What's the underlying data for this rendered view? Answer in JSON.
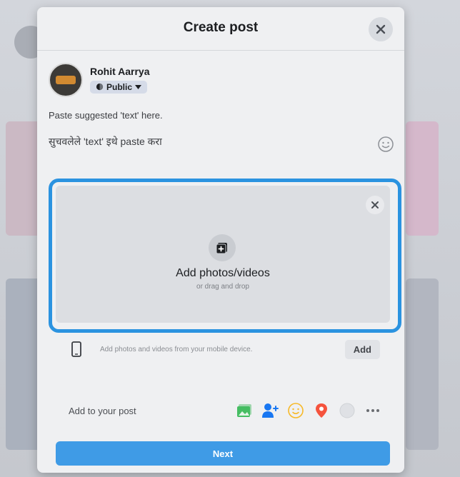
{
  "modal": {
    "title": "Create post",
    "close_icon": "close-icon"
  },
  "user": {
    "name": "Rohit Aarrya",
    "privacy": "Public",
    "privacy_icon": "globe-icon"
  },
  "post": {
    "line1": "Paste suggested 'text' here.",
    "line2": "सुचवलेले 'text' इथे paste करा",
    "emoji_icon": "smiley-icon"
  },
  "upload": {
    "title": "Add photos/videos",
    "subtitle": "or drag and drop",
    "icon": "add-photo-icon",
    "close_icon": "close-icon",
    "highlight_color": "#2b93e0"
  },
  "mobile": {
    "text": "Add photos and videos from your mobile device.",
    "button": "Add",
    "icon": "mobile-phone-icon"
  },
  "add_to_post": {
    "label": "Add to your post",
    "icons": [
      "photo-icon",
      "tag-people-icon",
      "feeling-icon",
      "location-icon",
      "gif-icon",
      "more-icon"
    ]
  },
  "next_button": "Next",
  "colors": {
    "primary": "#3f9be6",
    "photo_green": "#45bd62",
    "tag_blue": "#1877f2",
    "feeling_yellow": "#f7b928",
    "location_red": "#f5533d"
  }
}
